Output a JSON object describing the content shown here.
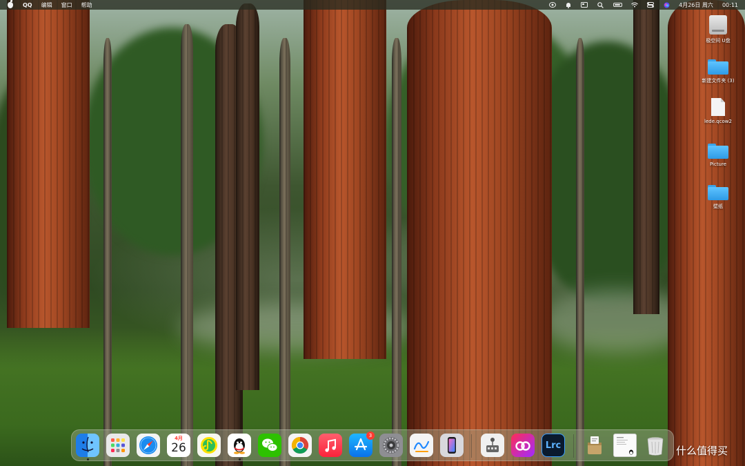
{
  "menubar": {
    "app_name": "QQ",
    "menus": [
      "编辑",
      "窗口",
      "帮助"
    ],
    "date": "4月26日 周六",
    "time": "00:11",
    "icons": [
      "apple-icon",
      "qq-status-icon",
      "notification-icon",
      "display-icon",
      "search-icon",
      "battery-icon",
      "wifi-icon",
      "control-center-icon",
      "siri-icon"
    ]
  },
  "desktop": {
    "icons": [
      {
        "label": "极空间 U盘",
        "type": "drive-icon"
      },
      {
        "label": "新建文件夹 (3)",
        "type": "folder-icon"
      },
      {
        "label": "lede.qcow2",
        "type": "document-icon"
      },
      {
        "label": "Picture",
        "type": "folder-icon"
      },
      {
        "label": "壁纸",
        "type": "folder-icon"
      }
    ]
  },
  "dock": {
    "calendar_month": "4月",
    "calendar_day": "26",
    "appstore_badge": "3",
    "lightroom_label": "Lrc",
    "apps": [
      "finder-icon",
      "launchpad-icon",
      "safari-icon",
      "calendar-icon",
      "qq-music-icon",
      "qq-icon",
      "wechat-icon",
      "chrome-icon",
      "music-icon",
      "app-store-icon",
      "system-settings-icon",
      "freeform-icon",
      "iphone-mirroring-icon",
      "network-app-icon",
      "creative-cloud-icon",
      "lightroom-classic-icon",
      "installer-icon",
      "screenshot-thumb-icon",
      "trash-icon"
    ]
  },
  "watermark": "什么值得买"
}
